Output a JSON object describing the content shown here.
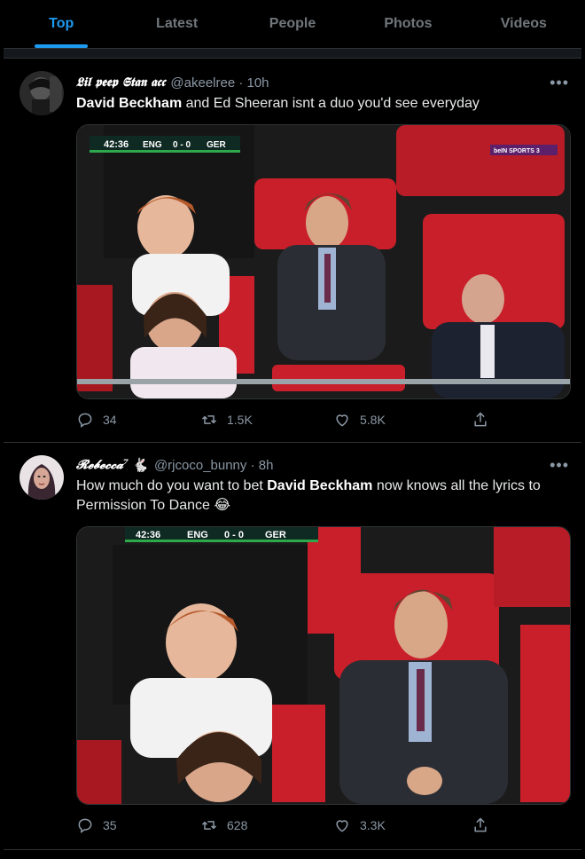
{
  "tabs": [
    "Top",
    "Latest",
    "People",
    "Photos",
    "Videos"
  ],
  "tweets": [
    {
      "name": "𝕷𝖎𝖑 𝖕𝖊𝖊𝖕 𝕾𝖙𝖆𝖓 𝖆𝖈𝖈",
      "handle": "@akeelree · 10h",
      "text_bold": "David Beckham",
      "text_rest": " and Ed Sheeran isnt a duo you'd see everyday",
      "scoreboard": {
        "time": "42:36",
        "home": "ENG",
        "score": "0 - 0",
        "away": "GER"
      },
      "broadcaster": "beIN SPORTS 3",
      "replies": "34",
      "retweets": "1.5K",
      "likes": "5.8K"
    },
    {
      "name": "𝓡𝓮𝓫𝓮𝓬𝓬𝓪⁷",
      "handle": "@rjcoco_bunny · 8h",
      "text_pre": "How much do you want to bet ",
      "text_bold": "David Beckham",
      "text_rest": " now knows all the lyrics to Permission To Dance 😂",
      "scoreboard": {
        "time": "42:36",
        "home": "ENG",
        "score": "0 - 0",
        "away": "GER"
      },
      "replies": "35",
      "retweets": "628",
      "likes": "3.3K"
    }
  ],
  "icons": {
    "more": "more-dots-icon",
    "reply": "reply-icon",
    "retweet": "retweet-icon",
    "like": "heart-icon",
    "share": "share-icon",
    "bunny": "rabbit-emoji"
  },
  "colors": {
    "accent": "#1d9bf0",
    "background": "#000000",
    "muted": "#8b98a5",
    "seat_red": "#c91f2a"
  }
}
